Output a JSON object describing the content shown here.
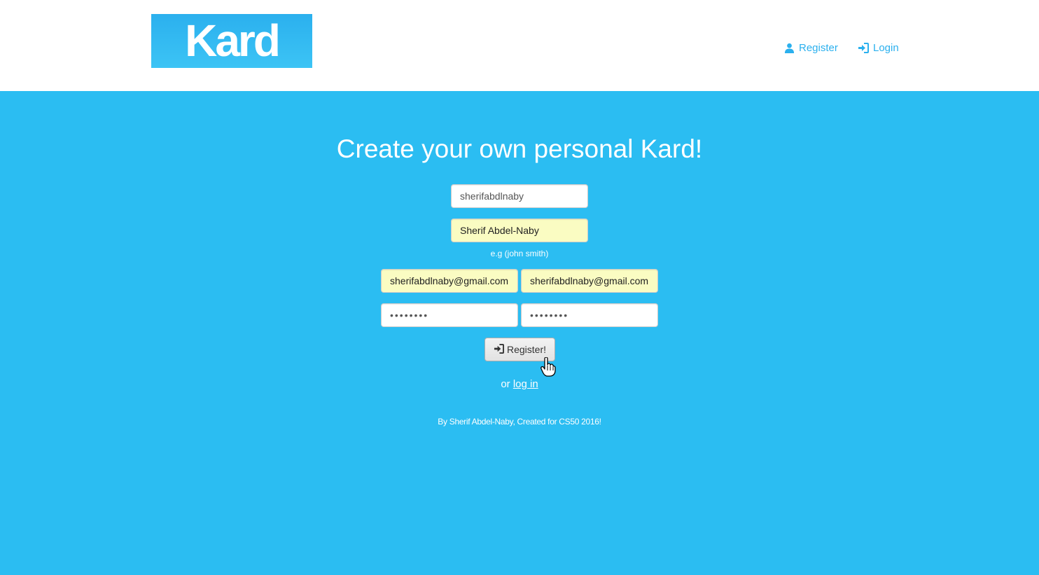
{
  "brand": {
    "logo_text": "Kard",
    "logo_color": "#2bb0ee",
    "page_background": "#2bbdf2"
  },
  "nav": {
    "register": {
      "icon": "user-icon",
      "label": "Register"
    },
    "login": {
      "icon": "login-icon",
      "label": "Login"
    }
  },
  "main": {
    "headline": "Create your own personal Kard!",
    "username": {
      "value": "sherifabdlnaby"
    },
    "fullname": {
      "value": "Sherif Abdel-Naby"
    },
    "fullname_hint": "e.g (john smith)",
    "email": {
      "value": "sherifabdlnaby@gmail.com"
    },
    "email_confirm": {
      "value": "sherifabdlnaby@gmail.com"
    },
    "password": {
      "value": "••••••••"
    },
    "password_confirm": {
      "value": "••••••••"
    },
    "register_button": {
      "icon": "login-icon",
      "label": "Register!"
    },
    "alt_prefix": "or",
    "alt_link": "log in"
  },
  "footer": {
    "text": "By Sherif Abdel-Naby, Created for CS50 2016!"
  },
  "cursor": {
    "icon": "hand-pointer-icon"
  }
}
